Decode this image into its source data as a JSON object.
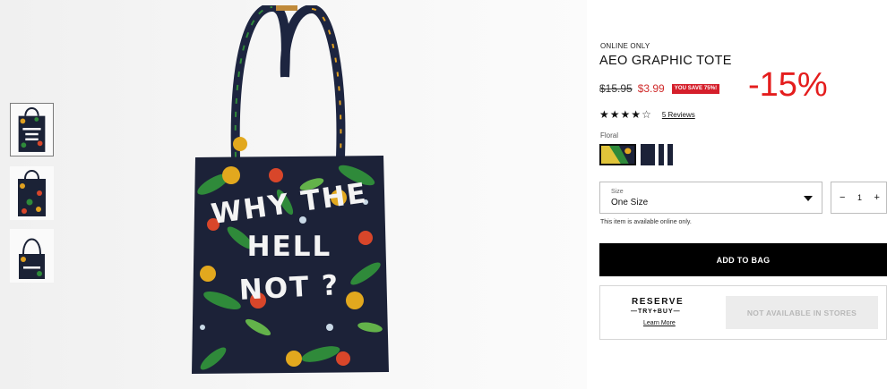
{
  "gallery": {
    "bag_slogan_lines": [
      "WHY THE",
      "HELL",
      "NOT ?"
    ],
    "thumbnails": [
      {
        "view": "front",
        "selected": true
      },
      {
        "view": "back",
        "selected": false
      },
      {
        "view": "folded",
        "selected": false
      }
    ]
  },
  "product": {
    "eyebrow": "ONLINE ONLY",
    "title": "AEO GRAPHIC TOTE",
    "old_price": "$15.95",
    "new_price": "$3.99",
    "save_badge": "YOU SAVE 75%!",
    "discount_overlay": "-15%",
    "rating_value": 4,
    "rating_max": 5,
    "reviews_link": "5 Reviews",
    "color_label": "Floral",
    "swatches": [
      {
        "name": "floral",
        "selected": true
      },
      {
        "name": "navy-stripe",
        "selected": false
      }
    ],
    "size": {
      "label": "Size",
      "value": "One Size"
    },
    "quantity": {
      "minus": "−",
      "value": "1",
      "plus": "+"
    },
    "availability_note": "This item is available online only.",
    "add_to_bag": "ADD TO BAG",
    "reserve": {
      "title": "RESERVE",
      "subtitle": "—TRY+BUY—",
      "learn_more": "Learn More",
      "store_status": "NOT AVAILABLE IN STORES"
    }
  },
  "colors": {
    "sale_red": "#d02b2b",
    "badge_red": "#d51f2b",
    "overlay_red": "#e41d1d",
    "button_black": "#000000"
  }
}
